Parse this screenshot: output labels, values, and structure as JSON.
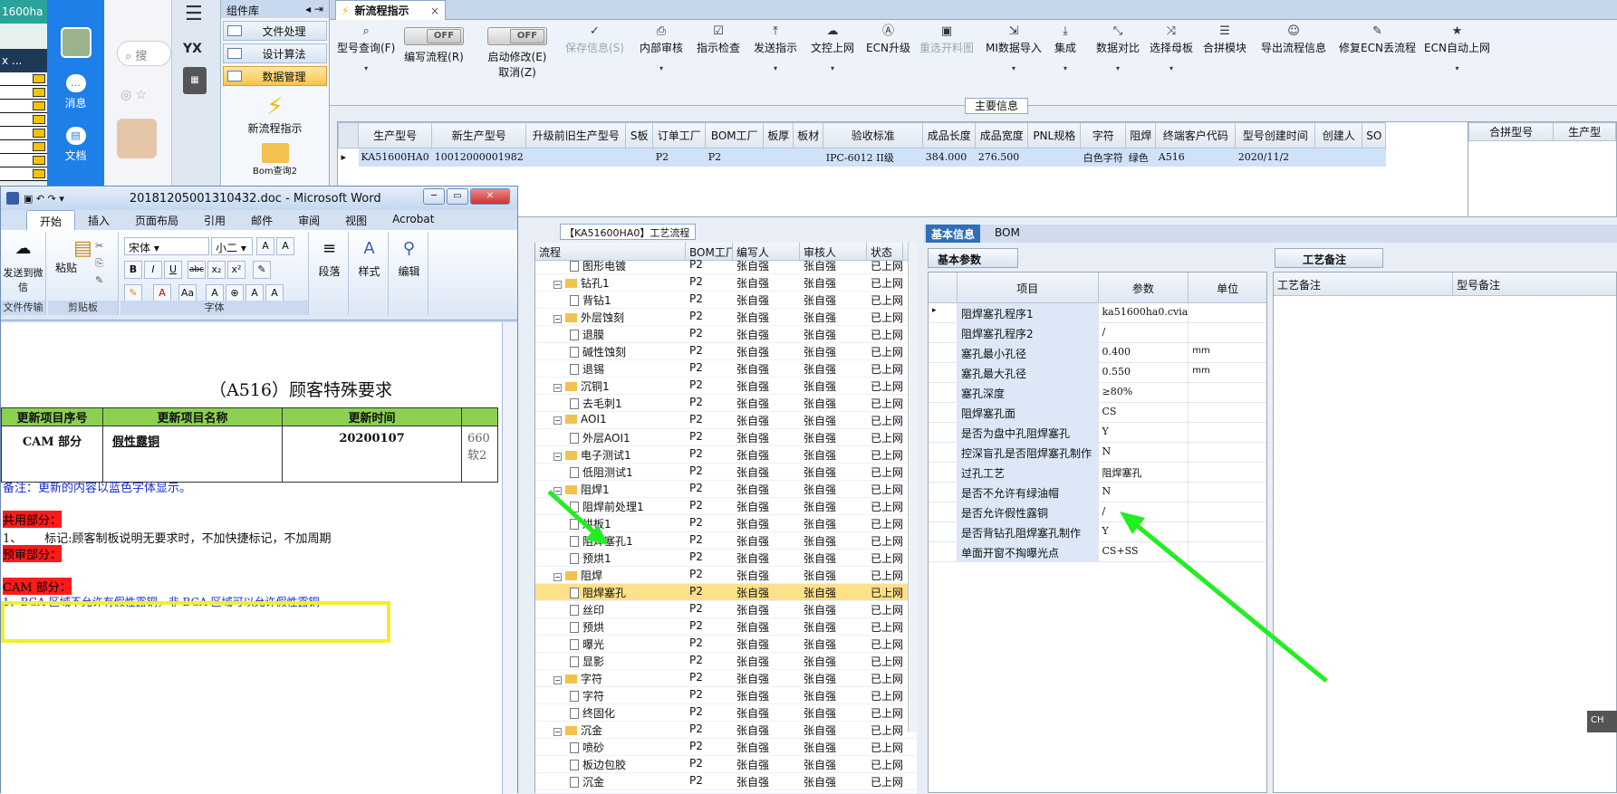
{
  "left": {
    "excel_cell": "1600ha",
    "excel_cell2": "x ...",
    "qq": {
      "msg": "消息",
      "doc": "文档",
      "search_placeholder": "搜"
    }
  },
  "appbar": {
    "yx": "YX"
  },
  "complib": {
    "title": "组件库",
    "items": [
      "文件处理",
      "设计算法",
      "数据管理"
    ],
    "new_flow": "新流程指示",
    "bom_query": "Bom查询2"
  },
  "tab": {
    "label": "新流程指示",
    "close": "×"
  },
  "ribbon": {
    "query": "型号查询(F)",
    "edit_flow": "编写流程(R)",
    "edit_flow_toggle": "OFF",
    "start_edit": "启动修改(E)",
    "start_edit_toggle": "OFF",
    "cancel": "取消(Z)",
    "save": "保存信息(S)",
    "buttons": [
      "内部审核",
      "指示检查",
      "发送指示",
      "文控上网",
      "ECN升级",
      "重选开料图",
      "MI数据导入",
      "集成",
      "数据对比",
      "选择母板",
      "合拼模块",
      "导出流程信息",
      "修复ECN丢流程",
      "ECN自动上网"
    ]
  },
  "main": {
    "title": "主要信息",
    "headers": [
      "生产型号",
      "新生产型号",
      "升级前旧生产型号",
      "S板",
      "订单工厂",
      "BOM工厂",
      "板厚",
      "板材",
      "验收标准",
      "成品长度",
      "成品宽度",
      "PNL规格",
      "字符",
      "阻焊",
      "终端客户代码",
      "型号创建时间",
      "创建人",
      "SO"
    ],
    "row": [
      "KA51600HA0",
      "10012000001982",
      "",
      "",
      "P2",
      "P2",
      "",
      "",
      "IPC-6012 II级",
      "384.000",
      "276.500",
      "",
      "白色字符",
      "绿色",
      "A516",
      "2020/11/2",
      "",
      ""
    ],
    "merge_headers": [
      "合拼型号",
      "生产型"
    ]
  },
  "process": {
    "title": "【KA51600HA0】工艺流程",
    "headers": [
      "流程",
      "BOM工厂",
      "编写人",
      "审核人",
      "状态"
    ],
    "rows": [
      {
        "lvl": 2,
        "t": "doc",
        "name": "图形电镀",
        "f": "P2",
        "w": "张自强",
        "a": "张自强",
        "s": "已上网"
      },
      {
        "lvl": 1,
        "t": "folder",
        "name": "钻孔1",
        "f": "P2",
        "w": "张自强",
        "a": "张自强",
        "s": "已上网"
      },
      {
        "lvl": 2,
        "t": "doc",
        "name": "背钻1",
        "f": "P2",
        "w": "张自强",
        "a": "张自强",
        "s": "已上网"
      },
      {
        "lvl": 1,
        "t": "folder",
        "name": "外层蚀刻",
        "f": "P2",
        "w": "张自强",
        "a": "张自强",
        "s": "已上网"
      },
      {
        "lvl": 2,
        "t": "doc",
        "name": "退膜",
        "f": "P2",
        "w": "张自强",
        "a": "张自强",
        "s": "已上网"
      },
      {
        "lvl": 2,
        "t": "doc",
        "name": "碱性蚀刻",
        "f": "P2",
        "w": "张自强",
        "a": "张自强",
        "s": "已上网"
      },
      {
        "lvl": 2,
        "t": "doc",
        "name": "退锡",
        "f": "P2",
        "w": "张自强",
        "a": "张自强",
        "s": "已上网"
      },
      {
        "lvl": 1,
        "t": "folder",
        "name": "沉铜1",
        "f": "P2",
        "w": "张自强",
        "a": "张自强",
        "s": "已上网"
      },
      {
        "lvl": 2,
        "t": "doc",
        "name": "去毛刺1",
        "f": "P2",
        "w": "张自强",
        "a": "张自强",
        "s": "已上网"
      },
      {
        "lvl": 1,
        "t": "folder",
        "name": "AOI1",
        "f": "P2",
        "w": "张自强",
        "a": "张自强",
        "s": "已上网"
      },
      {
        "lvl": 2,
        "t": "doc",
        "name": "外层AOI1",
        "f": "P2",
        "w": "张自强",
        "a": "张自强",
        "s": "已上网"
      },
      {
        "lvl": 1,
        "t": "folder",
        "name": "电子测试1",
        "f": "P2",
        "w": "张自强",
        "a": "张自强",
        "s": "已上网"
      },
      {
        "lvl": 2,
        "t": "doc",
        "name": "低阻测试1",
        "f": "P2",
        "w": "张自强",
        "a": "张自强",
        "s": "已上网"
      },
      {
        "lvl": 1,
        "t": "folder",
        "name": "阻焊1",
        "f": "P2",
        "w": "张自强",
        "a": "张自强",
        "s": "已上网"
      },
      {
        "lvl": 2,
        "t": "doc",
        "name": "阻焊前处理1",
        "f": "P2",
        "w": "张自强",
        "a": "张自强",
        "s": "已上网"
      },
      {
        "lvl": 2,
        "t": "doc",
        "name": "烘板1",
        "f": "P2",
        "w": "张自强",
        "a": "张自强",
        "s": "已上网"
      },
      {
        "lvl": 2,
        "t": "doc",
        "name": "阻焊塞孔1",
        "f": "P2",
        "w": "张自强",
        "a": "张自强",
        "s": "已上网"
      },
      {
        "lvl": 2,
        "t": "doc",
        "name": "预烘1",
        "f": "P2",
        "w": "张自强",
        "a": "张自强",
        "s": "已上网"
      },
      {
        "lvl": 1,
        "t": "folder",
        "name": "阻焊",
        "f": "P2",
        "w": "张自强",
        "a": "张自强",
        "s": "已上网"
      },
      {
        "lvl": 2,
        "t": "doc",
        "name": "阻焊塞孔",
        "f": "P2",
        "w": "张自强",
        "a": "张自强",
        "s": "已上网",
        "sel": true
      },
      {
        "lvl": 2,
        "t": "doc",
        "name": "丝印",
        "f": "P2",
        "w": "张自强",
        "a": "张自强",
        "s": "已上网"
      },
      {
        "lvl": 2,
        "t": "doc",
        "name": "预烘",
        "f": "P2",
        "w": "张自强",
        "a": "张自强",
        "s": "已上网"
      },
      {
        "lvl": 2,
        "t": "doc",
        "name": "曝光",
        "f": "P2",
        "w": "张自强",
        "a": "张自强",
        "s": "已上网"
      },
      {
        "lvl": 2,
        "t": "doc",
        "name": "显影",
        "f": "P2",
        "w": "张自强",
        "a": "张自强",
        "s": "已上网"
      },
      {
        "lvl": 1,
        "t": "folder",
        "name": "字符",
        "f": "P2",
        "w": "张自强",
        "a": "张自强",
        "s": "已上网"
      },
      {
        "lvl": 2,
        "t": "doc",
        "name": "字符",
        "f": "P2",
        "w": "张自强",
        "a": "张自强",
        "s": "已上网"
      },
      {
        "lvl": 2,
        "t": "doc",
        "name": "终固化",
        "f": "P2",
        "w": "张自强",
        "a": "张自强",
        "s": "已上网"
      },
      {
        "lvl": 1,
        "t": "folder",
        "name": "沉金",
        "f": "P2",
        "w": "张自强",
        "a": "张自强",
        "s": "已上网"
      },
      {
        "lvl": 2,
        "t": "doc",
        "name": "喷砂",
        "f": "P2",
        "w": "张自强",
        "a": "张自强",
        "s": "已上网"
      },
      {
        "lvl": 2,
        "t": "doc",
        "name": "板边包胶",
        "f": "P2",
        "w": "张自强",
        "a": "张自强",
        "s": "已上网"
      },
      {
        "lvl": 2,
        "t": "doc",
        "name": "沉金",
        "f": "P2",
        "w": "张自强",
        "a": "张自强",
        "s": "已上网"
      }
    ]
  },
  "basic": {
    "tabs": [
      "基本信息",
      "BOM"
    ],
    "section": "基本参数",
    "headers": [
      "项目",
      "参数",
      "单位"
    ],
    "rows": [
      {
        "k": "阻焊塞孔程序1",
        "v": "ka51600ha0.cvia",
        "u": ""
      },
      {
        "k": "阻焊塞孔程序2",
        "v": "/",
        "u": ""
      },
      {
        "k": "塞孔最小孔径",
        "v": "0.400",
        "u": "mm"
      },
      {
        "k": "塞孔最大孔径",
        "v": "0.550",
        "u": "mm"
      },
      {
        "k": "塞孔深度",
        "v": "≥80%",
        "u": ""
      },
      {
        "k": "阻焊塞孔面",
        "v": "CS",
        "u": ""
      },
      {
        "k": "是否为盘中孔阻焊塞孔",
        "v": "Y",
        "u": ""
      },
      {
        "k": "控深盲孔是否阻焊塞孔制作",
        "v": "N",
        "u": ""
      },
      {
        "k": "过孔工艺",
        "v": "阻焊塞孔",
        "u": ""
      },
      {
        "k": "是否不允许有绿油帽",
        "v": "N",
        "u": ""
      },
      {
        "k": "是否允许假性露铜",
        "v": "/",
        "u": ""
      },
      {
        "k": "是否背钻孔阻焊塞孔制作",
        "v": "Y",
        "u": ""
      },
      {
        "k": "单面开窗不掏曝光点",
        "v": "CS+SS",
        "u": ""
      }
    ]
  },
  "notes": {
    "section": "工艺备注",
    "headers": [
      "工艺备注",
      "型号备注"
    ],
    "badge": "CH"
  },
  "word": {
    "title": "20181205001310432.doc - Microsoft Word",
    "tabs": [
      "开始",
      "插入",
      "页面布局",
      "引用",
      "邮件",
      "审阅",
      "视图",
      "Acrobat"
    ],
    "font": "宋体",
    "size": "小二",
    "groups": {
      "send": "发送到微信",
      "transfer": "文件传输",
      "paste": "粘贴",
      "clipboard": "剪贴板",
      "font": "字体",
      "para": "段落",
      "style": "样式",
      "edit": "编辑"
    },
    "doc_title": "（A516）顾客特殊要求",
    "table_headers": [
      "更新项目序号",
      "更新项目名称",
      "更新时间",
      ""
    ],
    "table_row": [
      "CAM 部分",
      "假性露铜",
      "20200107",
      "660"
    ],
    "table_row_extra": "软2",
    "note": "备注：更新的内容以蓝色字体显示。",
    "shared": "共用部分：",
    "line1_num": "1、",
    "line1": "标记:顾客制板说明无要求时，不加快捷标记，不加周期",
    "prereview": "预审部分：",
    "cam": "CAM 部分：",
    "bga": "1、BGA 区域不允许有假性露铜，非 BGA 区域可以允许假性露铜"
  }
}
